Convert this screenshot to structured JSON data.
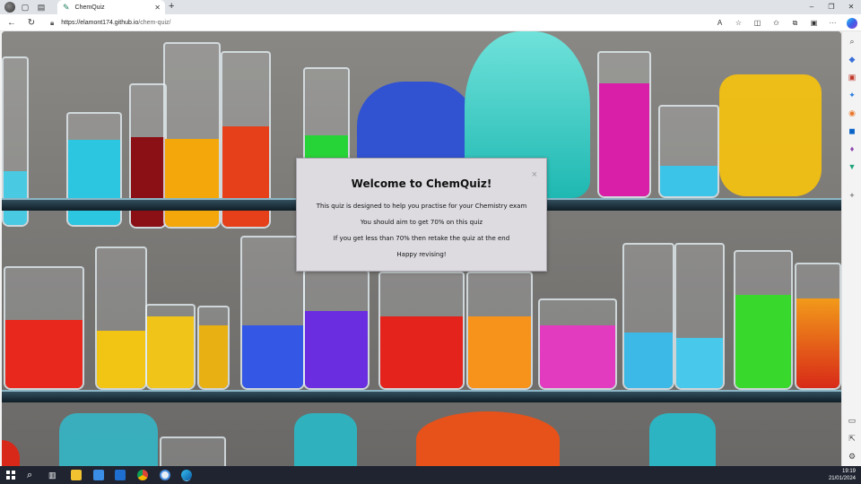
{
  "browser": {
    "tab_title": "ChemQuiz",
    "new_tab_glyph": "+",
    "url_host": "https://elamont174.github.io",
    "url_path": "/chem-quiz/",
    "window_controls": [
      "–",
      "❐",
      "✕"
    ]
  },
  "modal": {
    "title": "Welcome to ChemQuiz!",
    "close_glyph": "×",
    "lines": [
      "This quiz is designed to help you practise for your Chemistry exam",
      "You should aim to get 70% on this quiz",
      "If you get less than 70% then retake the quiz at the end",
      "Happy revising!"
    ]
  },
  "taskbar": {
    "time": "19:19",
    "date": "21/01/2024"
  },
  "icons": {
    "back": "back-arrow-icon",
    "refresh": "refresh-icon",
    "lock": "lock-icon",
    "favorite": "star-icon",
    "windows": "windows-start-icon",
    "search": "search-icon"
  }
}
